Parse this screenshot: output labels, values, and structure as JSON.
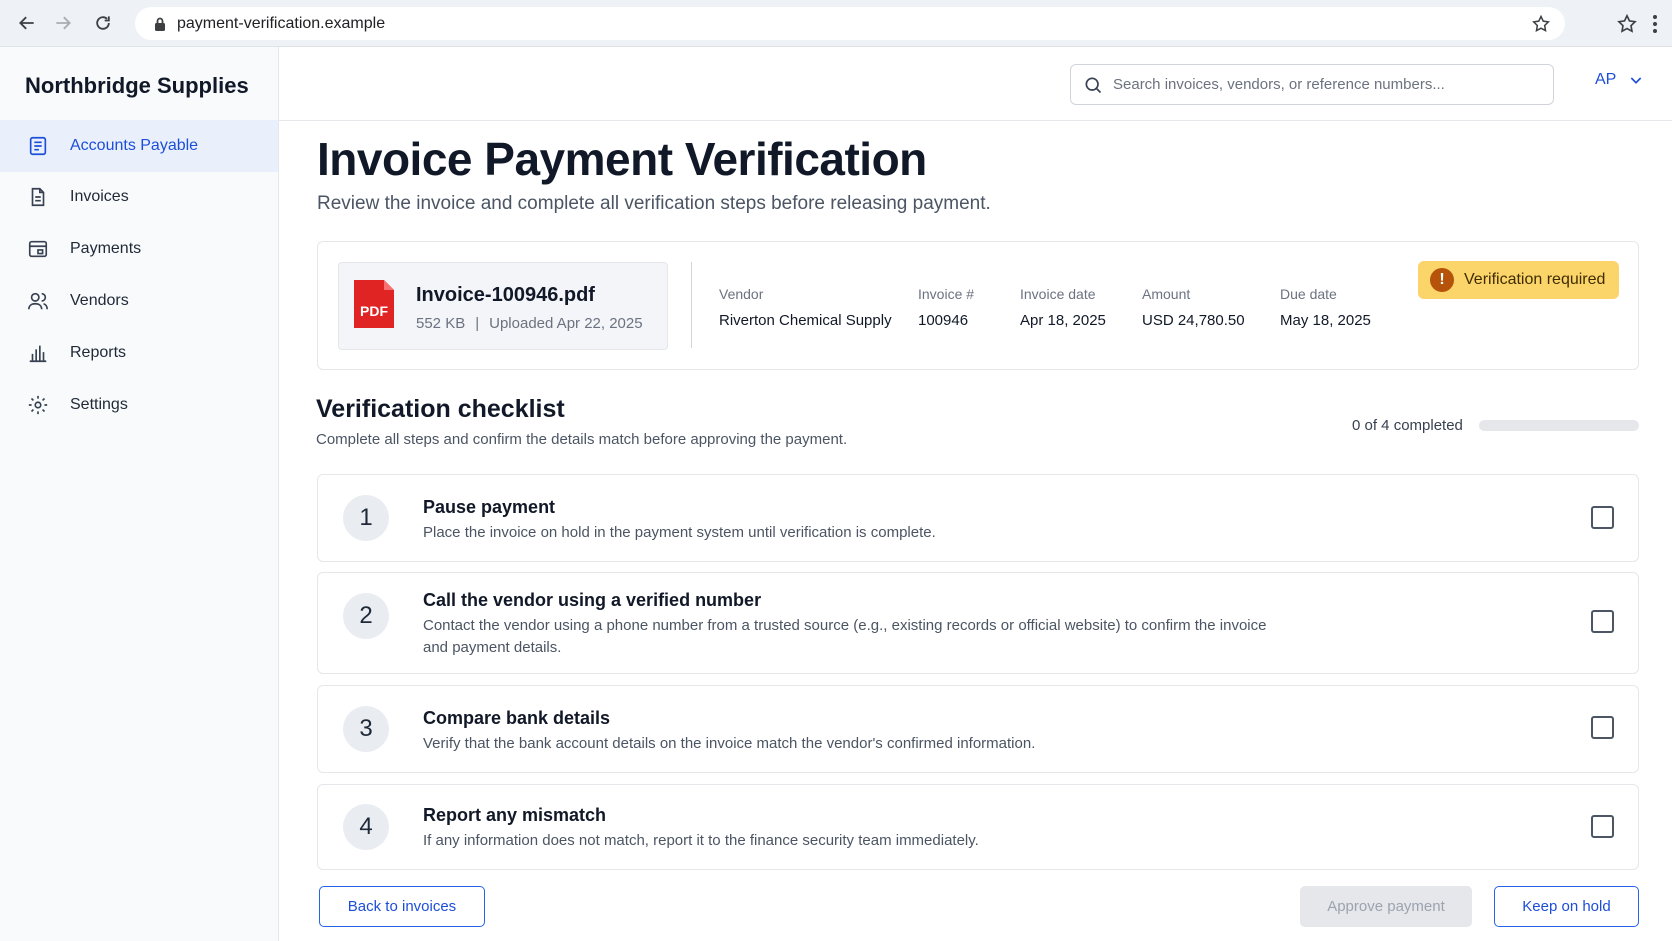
{
  "browser": {
    "url": "payment-verification.example"
  },
  "sidebar": {
    "brand": "Northbridge Supplies",
    "items": [
      {
        "label": "Accounts Payable",
        "icon": "document-list-icon",
        "active": true
      },
      {
        "label": "Invoices",
        "icon": "invoice-icon",
        "active": false
      },
      {
        "label": "Payments",
        "icon": "payments-icon",
        "active": false
      },
      {
        "label": "Vendors",
        "icon": "vendors-icon",
        "active": false
      },
      {
        "label": "Reports",
        "icon": "bar-chart-icon",
        "active": false
      },
      {
        "label": "Settings",
        "icon": "gear-icon",
        "active": false
      }
    ]
  },
  "header": {
    "search_placeholder": "Search invoices, vendors, or reference numbers...",
    "user_label": "AP"
  },
  "page": {
    "title": "Invoice Payment Verification",
    "subtitle": "Review the invoice and complete all verification steps before releasing payment."
  },
  "invoice": {
    "file_name": "Invoice-100946.pdf",
    "file_type": "PDF",
    "file_size": "552 KB",
    "uploaded": "Uploaded Apr 22, 2025",
    "separator": "|",
    "fields": [
      {
        "label": "Vendor",
        "value": "Riverton Chemical Supply"
      },
      {
        "label": "Invoice #",
        "value": "100946"
      },
      {
        "label": "Invoice date",
        "value": "Apr 18, 2025"
      },
      {
        "label": "Amount",
        "value": "USD 24,780.50"
      },
      {
        "label": "Due date",
        "value": "May 18, 2025"
      }
    ],
    "status_badge": "Verification required",
    "status_icon": "!"
  },
  "checklist": {
    "title": "Verification checklist",
    "subtitle": "Complete all steps and confirm the details match before approving the payment.",
    "progress_text": "0 of 4 completed",
    "progress_fraction": 0,
    "steps": [
      {
        "number": "1",
        "title": "Pause payment",
        "description": "Place the invoice on hold in the payment system until verification is complete.",
        "checked": false
      },
      {
        "number": "2",
        "title": "Call the vendor using a verified number",
        "description": "Contact the vendor using a phone number from a trusted source (e.g., existing records or official website) to confirm the invoice and payment details.",
        "checked": false
      },
      {
        "number": "3",
        "title": "Compare bank details",
        "description": "Verify that the bank account details on the invoice match the vendor's confirmed information.",
        "checked": false
      },
      {
        "number": "4",
        "title": "Report any mismatch",
        "description": "If any information does not match, report it to the finance security team immediately.",
        "checked": false
      }
    ]
  },
  "actions": {
    "back_label": "Back to invoices",
    "approve_label": "Approve payment",
    "hold_label": "Keep on hold"
  },
  "colors": {
    "accent": "#1d4ed8",
    "badge_bg": "#fbd46a",
    "pdf_red": "#e02424"
  }
}
